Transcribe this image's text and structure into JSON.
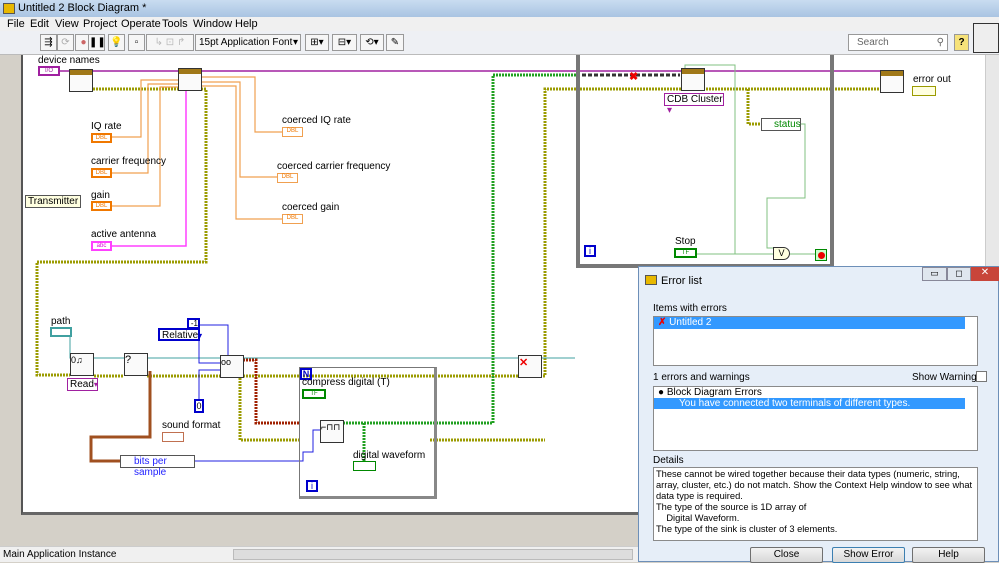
{
  "window": {
    "title": "Untitled 2 Block Diagram *"
  },
  "menu": [
    "File",
    "Edit",
    "View",
    "Project",
    "Operate",
    "Tools",
    "Window",
    "Help"
  ],
  "toolbar": {
    "font": "15pt Application Font",
    "search_placeholder": "Search",
    "help": "?"
  },
  "diagram": {
    "device_names": "device names",
    "device_names_term": "I/O",
    "iq_rate": "IQ rate",
    "carrier_frequency": "carrier frequency",
    "gain": "gain",
    "active_antenna": "active antenna",
    "dbl": "DBL",
    "abc": "abc",
    "transmitter": "Transmitter",
    "coerced_iq_rate": "coerced IQ rate",
    "coerced_carrier_frequency": "coerced carrier frequency",
    "coerced_gain": "coerced gain",
    "cdb_cluster": "CDB Cluster",
    "status": "status",
    "stop": "Stop",
    "tf": "TF",
    "error_out": "error out",
    "path": "path",
    "read": "Read",
    "relative": "Relative",
    "const_neg1": "-1",
    "const_0": "0",
    "question": "?",
    "sound_format": "sound format",
    "bits_per_sample": "bits per sample",
    "loop_n": "N",
    "loop_i": "i",
    "compress_digital": "compress digital (T)",
    "digital_waveform": "digital waveform",
    "or": "V"
  },
  "statusbar": {
    "context": "Main Application Instance"
  },
  "error_dialog": {
    "title": "Error list",
    "items_label": "Items with errors",
    "items": [
      "Untitled 2"
    ],
    "count_label": "1 errors and warnings",
    "show_warnings": "Show Warnings",
    "show_warnings_checked": false,
    "group": "Block Diagram Errors",
    "error": "You have connected two terminals of different types.",
    "details_label": "Details",
    "details": [
      "These cannot be wired together because their data types (numeric, string, array, cluster, etc.) do not match. Show the Context Help window to see what data type is required.",
      "The type of the source is 1D array of",
      "    Digital Waveform.",
      "The type of the sink is cluster of 3 elements."
    ],
    "buttons": {
      "close": "Close",
      "show_error": "Show Error",
      "help": "Help"
    }
  },
  "colors": {
    "dbl": "#f07800",
    "string": "#ff00ff",
    "error": "#9b9b00",
    "boolean": "#008000",
    "integer": "#0000ff",
    "path": "#008080",
    "refnum": "#800080",
    "waveform": "#a02000"
  }
}
